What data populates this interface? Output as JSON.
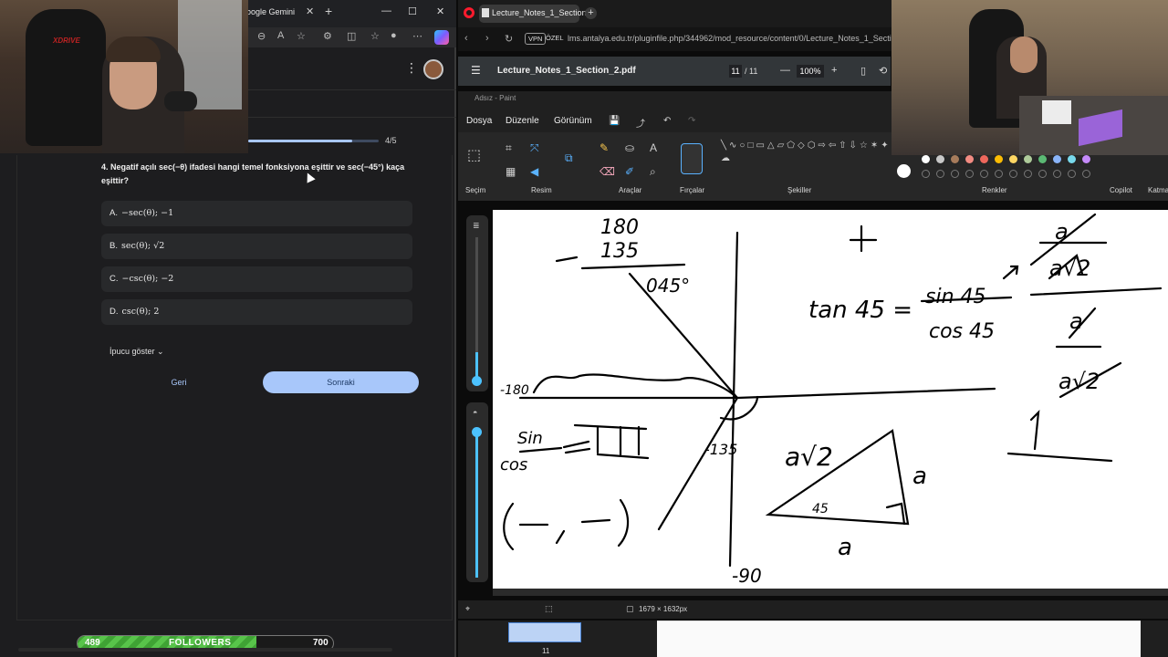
{
  "edge": {
    "tab_title": "oogle Gemini",
    "tab_close": "✕",
    "tab_plus": "+",
    "min": "—",
    "max": "☐",
    "close": "✕"
  },
  "webcam_left": {
    "chair_brand": "XDRIVE"
  },
  "quiz": {
    "progress_text": "4/5",
    "progress_fraction": 0.8,
    "question": "4. Negatif açılı sec(−θ) ifadesi hangi temel fonksiyona eşittir ve sec(−45°) kaça eşittir?",
    "options": [
      {
        "letter": "A.",
        "text": "−sec(θ); −1"
      },
      {
        "letter": "B.",
        "text": "sec(θ); √2"
      },
      {
        "letter": "C.",
        "text": "−csc(θ); −2"
      },
      {
        "letter": "D.",
        "text": "csc(θ); 2"
      }
    ],
    "hint": "İpucu göster ⌄",
    "back": "Geri",
    "next": "Sonraki"
  },
  "followers": {
    "current": "489",
    "label": "FOLLOWERS",
    "goal": "700",
    "progress_fraction": 0.699
  },
  "opera": {
    "tab_title": "Lecture_Notes_1_Section",
    "vpn": "VPN",
    "private": "ÖZEL",
    "url": "lms.antalya.edu.tr/pluginfile.php/344962/mod_resource/content/0/Lecture_Notes_1_Secti"
  },
  "pdf": {
    "menu_icon": "☰",
    "title": "Lecture_Notes_1_Section_2.pdf",
    "page": "11",
    "page_total": "/ 11",
    "minus": "—",
    "zoom": "100%",
    "plus": "+"
  },
  "paint": {
    "window_title": "Adsız - Paint",
    "menu": [
      "Dosya",
      "Düzenle",
      "Görünüm"
    ],
    "groups": [
      "Seçim",
      "Resim",
      "Araçlar",
      "Fırçalar",
      "Şekiller",
      "Renkler",
      "Copilot",
      "Katma"
    ],
    "shapes": "╲∿○□▭△▱⬠◇⬡⇨⇦⇧⇩☆✶✦☐⬭☁",
    "status_size": "1679 × 1632px",
    "thumb_page": "11",
    "colors": [
      "#ffffff",
      "#c8c8c8",
      "#a67b5b",
      "#f28b82",
      "#ee675c",
      "#fbbc04",
      "#fdd663",
      "#aecb9a",
      "#5bb974",
      "#8ab4f8",
      "#78d9ec",
      "#c58af9"
    ]
  },
  "canvas_text": {
    "n180": "180",
    "n135": "135",
    "n045": "045°",
    "tan": "tan 45 =",
    "sin45": "sin 45",
    "cos45": "cos 45",
    "sin": "Sin",
    "cos": "cos",
    "minus180": "-180",
    "minus135": "-135",
    "minus90": "-90",
    "a_root2": "a√2",
    "a_bottom": "a",
    "a_right": "a",
    "angle45": "45",
    "one": "1",
    "plus": "+"
  }
}
